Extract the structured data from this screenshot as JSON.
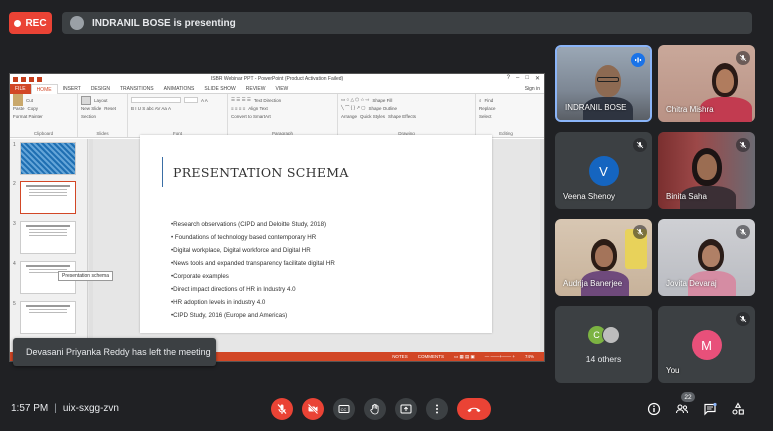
{
  "top_bar": {
    "rec_label": "REC",
    "presenting_text": "INDRANIL BOSE is presenting"
  },
  "presentation": {
    "window_title": "ISBR Webinar PPT - PowerPoint (Product Activation Failed)",
    "sign_in": "Sign in",
    "tabs": [
      "FILE",
      "HOME",
      "INSERT",
      "DESIGN",
      "TRANSITIONS",
      "ANIMATIONS",
      "SLIDE SHOW",
      "REVIEW",
      "VIEW"
    ],
    "active_tab": "HOME",
    "ribbon_groups": [
      "Clipboard",
      "Slides",
      "Font",
      "Paragraph",
      "Drawing",
      "Editing"
    ],
    "ribbon_items": {
      "paste": "Paste",
      "cut": "Cut",
      "copy": "Copy",
      "format_painter": "Format Painter",
      "new_slide": "New Slide",
      "layout": "Layout",
      "reset": "Reset",
      "section": "Section",
      "text_direction": "Text Direction",
      "align_text": "Align Text",
      "convert_smartart": "Convert to SmartArt",
      "arrange": "Arrange",
      "quick_styles": "Quick Styles",
      "shape_fill": "Shape Fill",
      "shape_outline": "Shape Outline",
      "shape_effects": "Shape Effects",
      "find": "Find",
      "replace": "Replace",
      "select": "Select"
    },
    "thumbnail_tooltip": "Presentation schema",
    "thumb_numbers": [
      "1",
      "2",
      "3",
      "4",
      "5"
    ],
    "slide": {
      "title": "PRESENTATION SCHEMA",
      "bullets": [
        "•Research observations (CIPD and Deloitte Study, 2018)",
        "• Foundations of technology based contemporary HR",
        "•Digital workplace, Digital workforce and Digital HR",
        "•News tools and expanded transparency facilitate digital HR",
        "•Corporate examples",
        "•Direct impact directions of HR in Industry 4.0",
        "•HR adoption levels in industry 4.0",
        "•CIPD Study, 2016 (Europe and Americas)"
      ]
    },
    "status": {
      "notes": "NOTES",
      "comments": "COMMENTS",
      "zoom": "74%"
    }
  },
  "toast": "Devasani Priyanka Reddy has left the meeting",
  "participants": [
    {
      "name": "INDRANIL BOSE",
      "speaking": true
    },
    {
      "name": "Chitra Mishra",
      "muted": true
    },
    {
      "name": "Veena Shenoy",
      "initial": "V",
      "avatar_color": "#1565c0",
      "muted": true
    },
    {
      "name": "Binita Saha",
      "muted": true
    },
    {
      "name": "Audrija Banerjee",
      "muted": true
    },
    {
      "name": "Jovita Devaraj",
      "muted": true
    },
    {
      "name": "14 others",
      "initial": "C"
    },
    {
      "name": "You",
      "initial": "M",
      "avatar_color": "#e8507a",
      "muted": true
    }
  ],
  "bottom_bar": {
    "time": "1:57 PM",
    "separator": "|",
    "meeting_code": "uix-sxgg-zvn",
    "people_count": "22"
  },
  "colors": {
    "background": "#202124",
    "danger": "#ea4335",
    "control": "#3c4043",
    "ppt_accent": "#d24726"
  }
}
